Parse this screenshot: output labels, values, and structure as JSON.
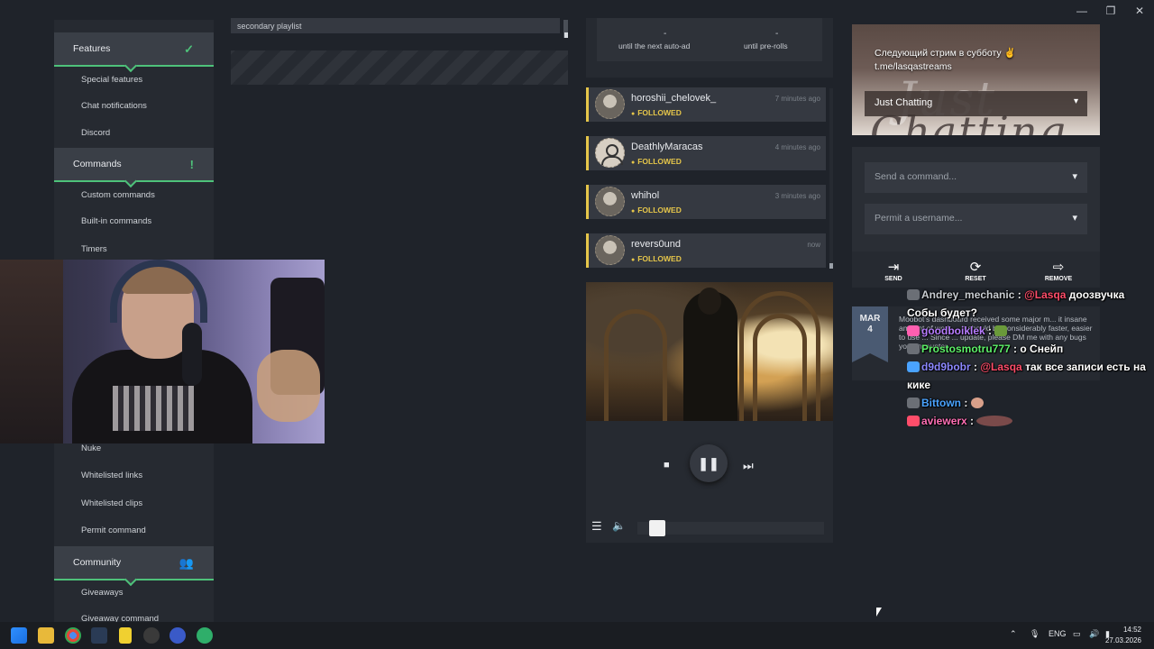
{
  "window": {
    "minimize": "—",
    "restore": "❐",
    "close": "✕"
  },
  "sidebar": {
    "sections": [
      {
        "label": "Features",
        "icon": "✓"
      },
      {
        "label": "Commands",
        "icon": "!"
      },
      {
        "label": "Community",
        "icon": "👥"
      }
    ],
    "features_items": [
      "Special features",
      "Chat notifications",
      "Discord"
    ],
    "commands_items": [
      "Custom commands",
      "Built-in commands",
      "Timers"
    ],
    "moderation_items": [
      "Nuke",
      "Whitelisted links",
      "Whitelisted clips",
      "Permit command"
    ],
    "community_items": [
      "Giveaways",
      "Giveaway command"
    ]
  },
  "playlist": {
    "label": "secondary playlist"
  },
  "ads": {
    "auto_ad_value": "-",
    "auto_ad_label": "until the next auto-ad",
    "preroll_value": "-",
    "preroll_label": "until pre-rolls"
  },
  "follows": [
    {
      "name": "horoshii_chelovek_",
      "status": "FOLLOWED",
      "time": "7 minutes ago"
    },
    {
      "name": "DeathlyMaracas",
      "status": "FOLLOWED",
      "time": "4 minutes ago"
    },
    {
      "name": "whihol",
      "status": "FOLLOWED",
      "time": "3 minutes ago"
    },
    {
      "name": "revers0und",
      "status": "FOLLOWED",
      "time": "now"
    }
  ],
  "player": {
    "stop": "■",
    "pause": "❚❚",
    "next": "⏭",
    "list": "☰",
    "volume": "🔈",
    "progress": 0.12
  },
  "stream": {
    "title_line1": "Следующий стрим в субботу ✌",
    "title_line2": "t.me/lasqastreams",
    "category": "Just Chatting",
    "bg_word1": "Just",
    "bg_word2": "Chatting"
  },
  "commands": {
    "send_placeholder": "Send a command...",
    "permit_placeholder": "Permit a username...",
    "send_label": "SEND",
    "reset_label": "RESET",
    "remove_label": "REMOVE"
  },
  "news": {
    "month": "MAR",
    "day": "4",
    "text": "Moobot's dashboard received some major m... it insane amount of work ... it should be considerably faster, easier to use ... Since ... update, please DM me with any bugs you encounter."
  },
  "chat": [
    {
      "user": "Andrey_mechanic",
      "sep": " : ",
      "mention": "@Lasqa",
      "text": " доозвучка Собы будет?"
    },
    {
      "user": "goodboiklek",
      "sep": " : ",
      "mention": "",
      "text": ""
    },
    {
      "user": "Prostosmotru777",
      "sep": " : ",
      "mention": "",
      "text": "о Снейп"
    },
    {
      "user": "d9d9bobr",
      "sep": " : ",
      "mention": "@Lasqa",
      "text": " так все записи есть на кике"
    },
    {
      "user": "Bittown",
      "sep": " : ",
      "mention": "",
      "text": ""
    },
    {
      "user": "aviewerx",
      "sep": " : ",
      "mention": "",
      "text": ""
    }
  ],
  "taskbar": {
    "lang": "ENG",
    "time": "14:52",
    "date": "27.03.2026"
  },
  "colors": {
    "accent": "#4ec27a",
    "follow": "#e6c64a",
    "background": "#1f232a"
  }
}
